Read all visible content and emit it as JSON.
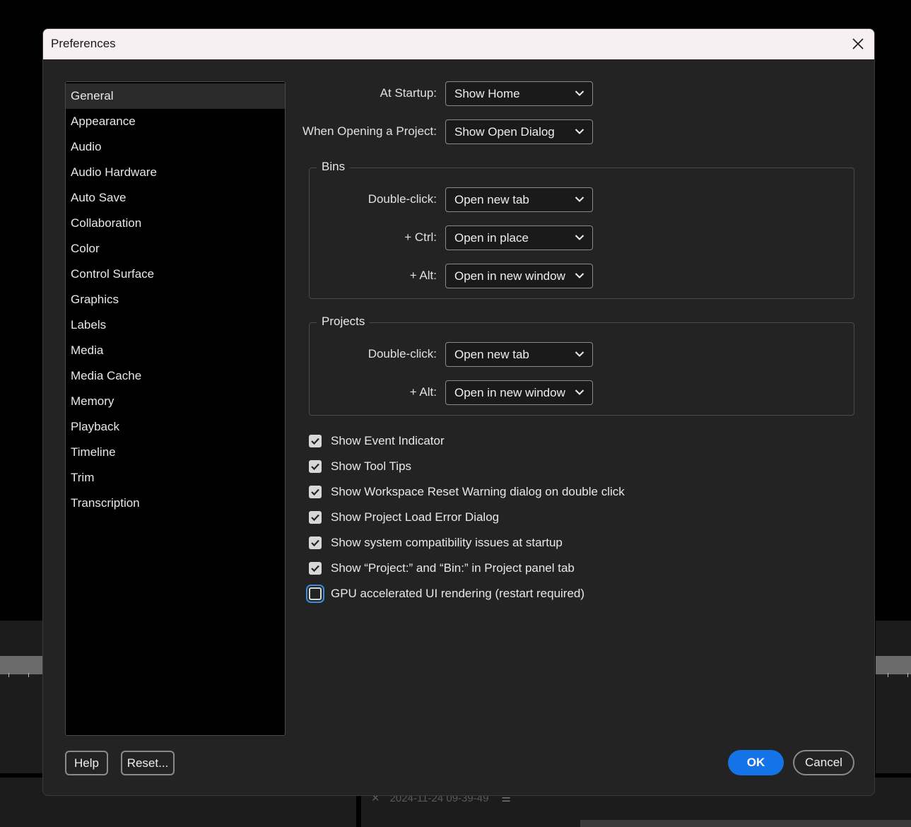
{
  "dialog": {
    "title": "Preferences"
  },
  "sidebar": {
    "items": [
      {
        "label": "General",
        "selected": true
      },
      {
        "label": "Appearance"
      },
      {
        "label": "Audio"
      },
      {
        "label": "Audio Hardware"
      },
      {
        "label": "Auto Save"
      },
      {
        "label": "Collaboration"
      },
      {
        "label": "Color"
      },
      {
        "label": "Control Surface"
      },
      {
        "label": "Graphics"
      },
      {
        "label": "Labels"
      },
      {
        "label": "Media"
      },
      {
        "label": "Media Cache"
      },
      {
        "label": "Memory"
      },
      {
        "label": "Playback"
      },
      {
        "label": "Timeline"
      },
      {
        "label": "Trim"
      },
      {
        "label": "Transcription"
      }
    ]
  },
  "general": {
    "at_startup": {
      "label": "At Startup:",
      "value": "Show Home"
    },
    "when_opening": {
      "label": "When Opening a Project:",
      "value": "Show Open Dialog"
    },
    "bins": {
      "legend": "Bins",
      "double_click": {
        "label": "Double-click:",
        "value": "Open new tab"
      },
      "ctrl": {
        "label": "+ Ctrl:",
        "value": "Open in place"
      },
      "alt": {
        "label": "+ Alt:",
        "value": "Open in new window"
      }
    },
    "projects": {
      "legend": "Projects",
      "double_click": {
        "label": "Double-click:",
        "value": "Open new tab"
      },
      "alt": {
        "label": "+ Alt:",
        "value": "Open in new window"
      }
    },
    "checkboxes": [
      {
        "label": "Show Event Indicator",
        "checked": true
      },
      {
        "label": "Show Tool Tips",
        "checked": true
      },
      {
        "label": "Show Workspace Reset Warning dialog on double click",
        "checked": true
      },
      {
        "label": "Show Project Load Error Dialog",
        "checked": true
      },
      {
        "label": "Show system compatibility issues at startup",
        "checked": true
      },
      {
        "label": "Show “Project:” and “Bin:” in Project panel tab",
        "checked": true
      },
      {
        "label": "GPU accelerated UI rendering (restart required)",
        "checked": false,
        "focused": true
      }
    ]
  },
  "footer": {
    "help_label": "Help",
    "reset_label": "Reset...",
    "ok_label": "OK",
    "cancel_label": "Cancel"
  },
  "background": {
    "tab_title": "2024-11-24 09-39-49"
  },
  "colors": {
    "accent": "#1473e6",
    "dialog_bg": "#232323",
    "titlebar_bg": "#f8eff2",
    "focus_ring": "#3d8be0"
  }
}
